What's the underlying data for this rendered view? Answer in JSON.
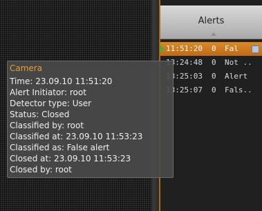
{
  "alerts_panel": {
    "title": "Alerts",
    "rows": [
      {
        "time": "11:51:20",
        "count": "0",
        "type": "Fal",
        "selected": true
      },
      {
        "time": "13:24:48",
        "count": "0",
        "type": "Not ..",
        "selected": false
      },
      {
        "time": "13:25:03",
        "count": "0",
        "type": "Alert",
        "selected": false
      },
      {
        "time": "13:25:07",
        "count": "0",
        "type": "Fals..",
        "selected": false
      }
    ]
  },
  "tooltip": {
    "title": "Camera",
    "lines": [
      "Time: 23.09.10 11:51:20",
      "Alert Initiator: root",
      "Detector type: User",
      "Status: Closed",
      "Classified by: root",
      "Classified at: 23.09.10 11:53:23",
      "Classified as: False alert",
      "Closed at: 23.09.10 11:53:23",
      "Closed by: root"
    ]
  },
  "colors": {
    "accent": "#c8741c",
    "tooltip_title": "#e3a033",
    "play_arrow": "#36b34a"
  },
  "icons": {
    "row_marker": "play-arrow-icon",
    "sort": "sort-arrow-icon",
    "row_menu": "row-menu-icon"
  }
}
